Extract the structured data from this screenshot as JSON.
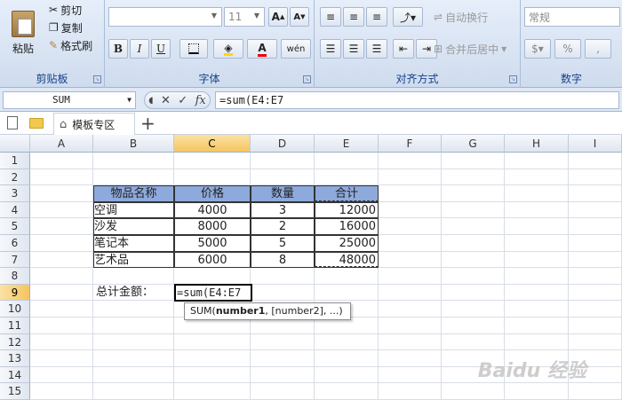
{
  "ribbon": {
    "clipboard": {
      "paste": "粘贴",
      "cut": "剪切",
      "copy": "复制",
      "format_painter": "格式刷",
      "label": "剪贴板"
    },
    "font": {
      "size": "11",
      "bold": "B",
      "italic": "I",
      "underline": "U",
      "label": "字体"
    },
    "alignment": {
      "wrap": "自动换行",
      "merge": "合并后居中",
      "label": "对齐方式"
    },
    "number": {
      "format": "常规",
      "percent": "%",
      "comma": ",",
      "label": "数字"
    }
  },
  "formula_bar": {
    "name_box": "SUM",
    "fx": "fx",
    "formula": "=sum(E4:E7"
  },
  "tabs": {
    "template": "模板专区",
    "add": "+"
  },
  "columns": [
    "A",
    "B",
    "C",
    "D",
    "E",
    "F",
    "G",
    "H",
    "I"
  ],
  "rows": [
    "1",
    "2",
    "3",
    "4",
    "5",
    "6",
    "7",
    "8",
    "9",
    "10",
    "11",
    "12",
    "13",
    "14",
    "15"
  ],
  "table": {
    "headers": [
      "物品名称",
      "价格",
      "数量",
      "合计"
    ],
    "rows": [
      [
        "空调",
        "4000",
        "3",
        "12000"
      ],
      [
        "沙发",
        "8000",
        "2",
        "16000"
      ],
      [
        "笔记本",
        "5000",
        "5",
        "25000"
      ],
      [
        "艺术品",
        "6000",
        "8",
        "48000"
      ]
    ]
  },
  "total_label": "总计金额：",
  "edit_text": "=sum(E4:E7",
  "tooltip": {
    "fn": "SUM(",
    "arg1": "number1",
    "rest": ", [number2], ...)"
  },
  "watermark": "Baidu 经验",
  "colors": {
    "header_fill": "#8ea9db",
    "selected_header": "#f5c55f",
    "ribbon": "#dbe5f3"
  }
}
